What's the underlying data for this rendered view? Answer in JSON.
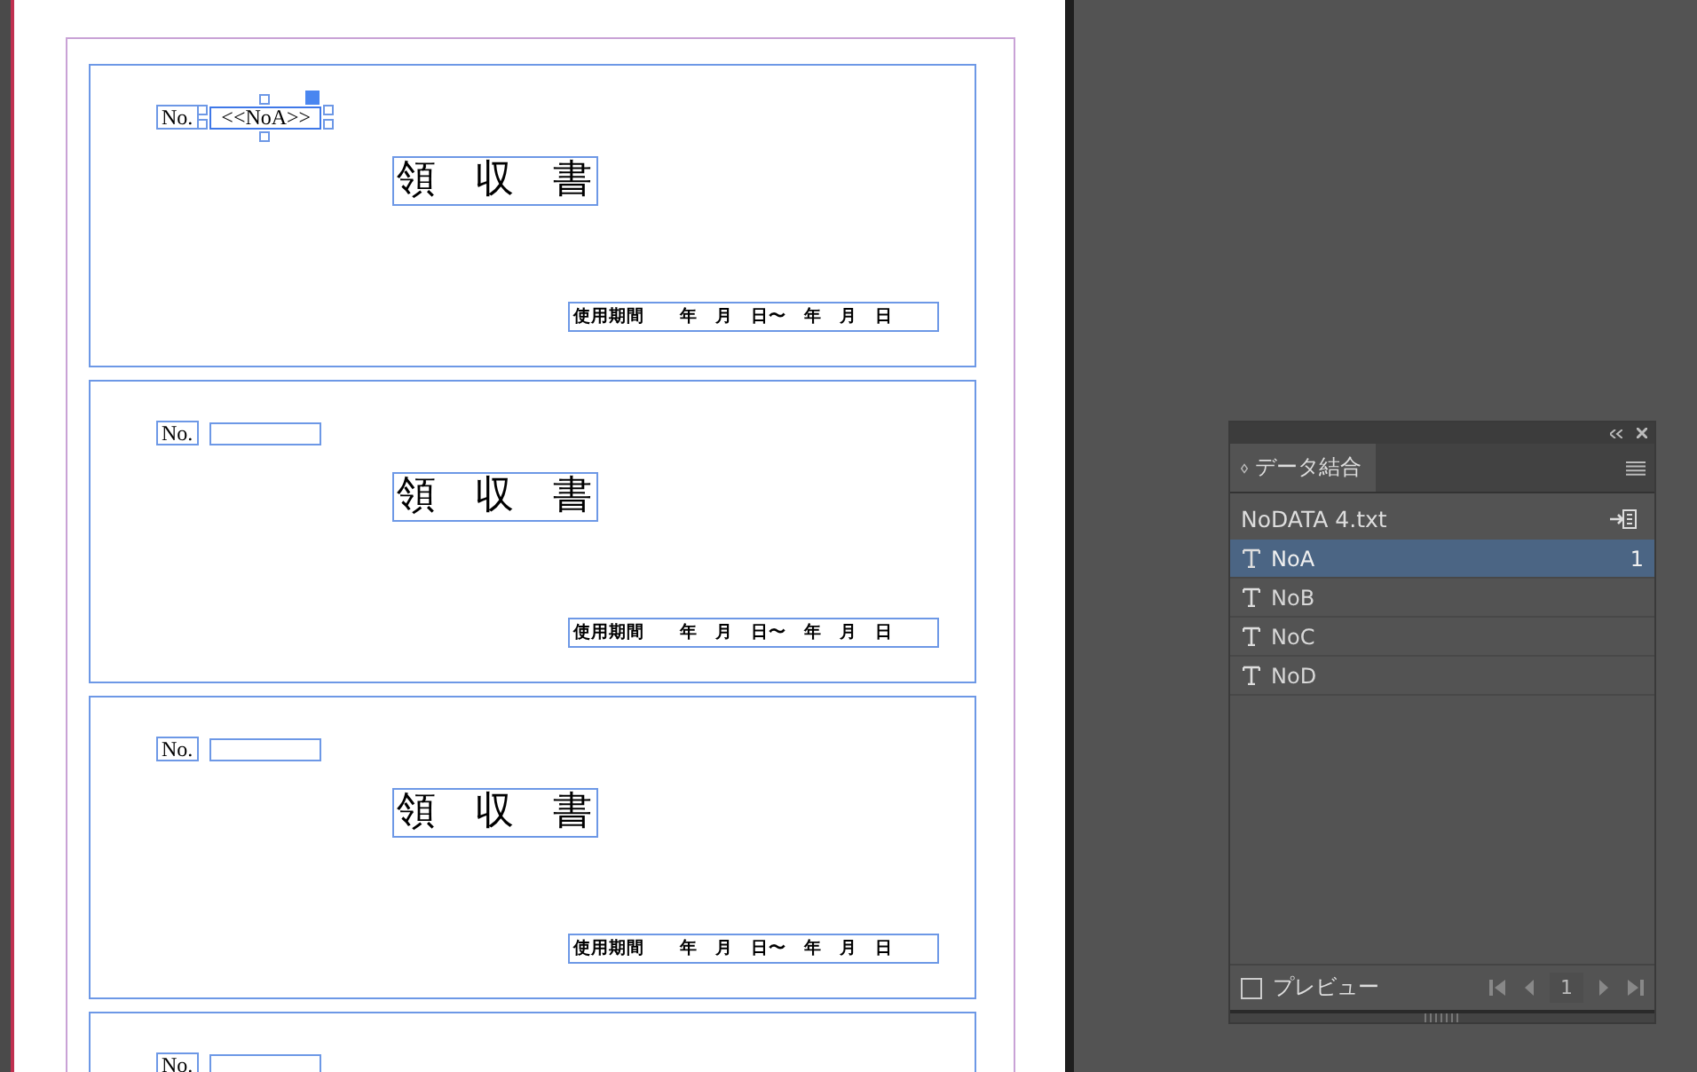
{
  "document": {
    "receipts": [
      {
        "no_label": "No.",
        "field": {
          "value": "<<NoA>>",
          "selected": true
        },
        "title": "領　収　書",
        "period": "使用期間　　年　月　日〜　年　月　日"
      },
      {
        "no_label": "No.",
        "field": {
          "selected": false
        },
        "title": "領　収　書",
        "period": "使用期間　　年　月　日〜　年　月　日"
      },
      {
        "no_label": "No.",
        "field": {
          "selected": false
        },
        "title": "領　収　書",
        "period": "使用期間　　年　月　日〜　年　月　日"
      },
      {
        "no_label": "No.",
        "field": {
          "selected": false
        }
      }
    ]
  },
  "panel": {
    "tab": "データ結合",
    "source": "NoDATA 4.txt",
    "fields": [
      {
        "name": "NoA",
        "selected": true,
        "record": "1"
      },
      {
        "name": "NoB",
        "selected": false
      },
      {
        "name": "NoC",
        "selected": false
      },
      {
        "name": "NoD",
        "selected": false
      }
    ],
    "preview": {
      "label": "プレビュー",
      "checked": false
    },
    "record": "1"
  }
}
